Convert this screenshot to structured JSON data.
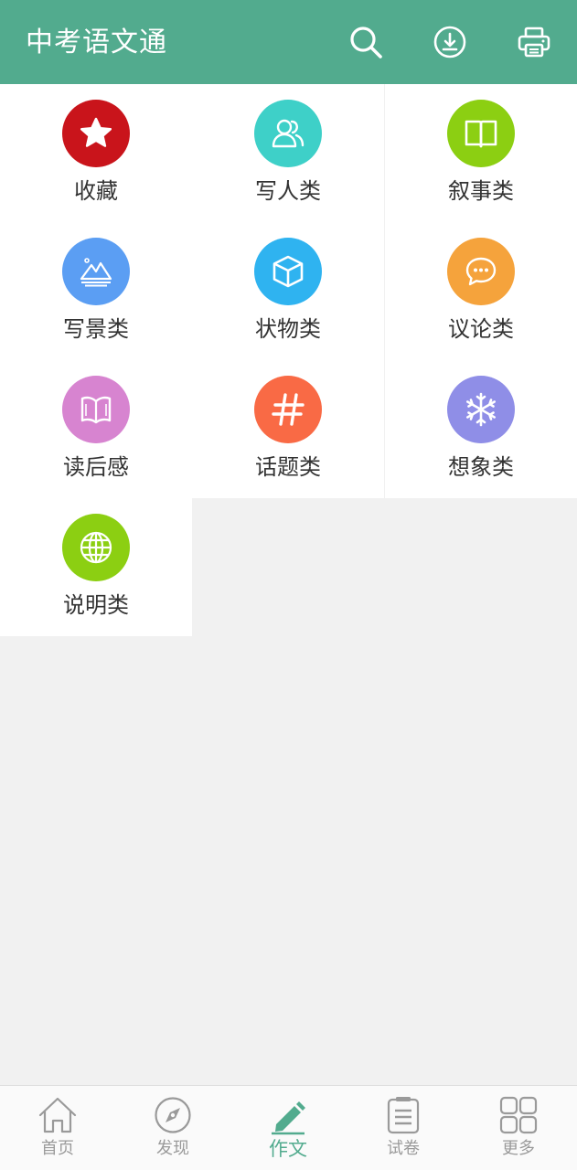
{
  "header": {
    "title": "中考语文通",
    "bg_color": "#52ab8e",
    "actions": [
      {
        "name": "search",
        "icon": "search-icon"
      },
      {
        "name": "download",
        "icon": "download-icon"
      },
      {
        "name": "print",
        "icon": "printer-icon"
      }
    ]
  },
  "categories": [
    {
      "label": "收藏",
      "icon": "star-icon",
      "color": "#c9141b"
    },
    {
      "label": "写人类",
      "icon": "people-icon",
      "color": "#3ed0c8"
    },
    {
      "label": "叙事类",
      "icon": "open-book-icon",
      "color": "#8ccf12"
    },
    {
      "label": "写景类",
      "icon": "mountain-icon",
      "color": "#5b9ef3"
    },
    {
      "label": "状物类",
      "icon": "cube-icon",
      "color": "#2fb3f0"
    },
    {
      "label": "议论类",
      "icon": "chat-bubble-icon",
      "color": "#f5a33c"
    },
    {
      "label": "读后感",
      "icon": "reading-book-icon",
      "color": "#d784d0"
    },
    {
      "label": "话题类",
      "icon": "hashtag-icon",
      "color": "#f96a45"
    },
    {
      "label": "想象类",
      "icon": "snowflake-icon",
      "color": "#8f8ee7"
    },
    {
      "label": "说明类",
      "icon": "globe-icon",
      "color": "#8ccf12"
    }
  ],
  "bottom_nav": {
    "active_color": "#52ab8e",
    "items": [
      {
        "label": "首页",
        "icon": "home-icon",
        "active": false
      },
      {
        "label": "发现",
        "icon": "compass-icon",
        "active": false
      },
      {
        "label": "作文",
        "icon": "pencil-icon",
        "active": true
      },
      {
        "label": "试卷",
        "icon": "clipboard-icon",
        "active": false
      },
      {
        "label": "更多",
        "icon": "grid-icon",
        "active": false
      }
    ]
  }
}
